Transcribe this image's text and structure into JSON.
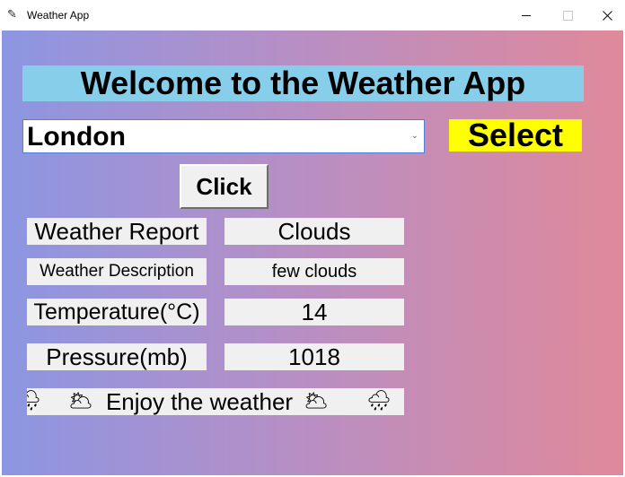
{
  "window": {
    "title": "Weather App",
    "icon": "feather-icon",
    "controls": [
      "minimize-icon",
      "maximize-icon",
      "close-icon"
    ]
  },
  "heading": "Welcome to the Weather App",
  "city_select": {
    "value": "London"
  },
  "select_label": "Select",
  "click_button": "Click",
  "report": {
    "weather_report_label": "Weather Report",
    "weather_report_value": "Clouds",
    "weather_description_label": "Weather Description",
    "weather_description_value": "few clouds",
    "temperature_label": "Temperature(°C)",
    "temperature_value": "14",
    "pressure_label": "Pressure(mb)",
    "pressure_value": "1018"
  },
  "marquee": {
    "text": "Enjoy the weather",
    "icons": [
      "cloud-rain-icon",
      "cloud-sun-icon",
      "cloud-sun-icon",
      "cloud-rain-icon"
    ]
  },
  "colors": {
    "background_gradient_start": "#8c96e2",
    "background_gradient_end": "#e0899a",
    "heading_bg": "#87ceeb",
    "select_label_bg": "#ffff00",
    "cell_bg": "#f0f0f0"
  }
}
